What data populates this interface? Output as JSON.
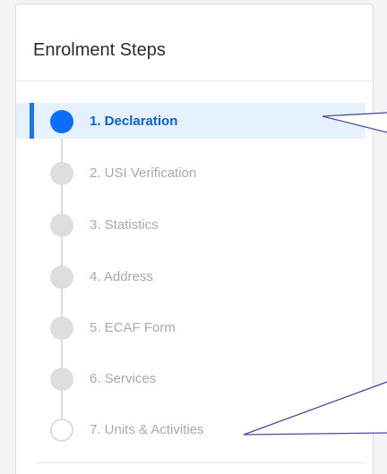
{
  "panel": {
    "title": "Enrolment Steps"
  },
  "steps": [
    {
      "label": "1. Declaration",
      "state": "current"
    },
    {
      "label": "2. USI Verification",
      "state": "pending"
    },
    {
      "label": "3. Statistics",
      "state": "pending"
    },
    {
      "label": "4. Address",
      "state": "pending"
    },
    {
      "label": "5. ECAF Form",
      "state": "pending"
    },
    {
      "label": "6. Services",
      "state": "pending"
    },
    {
      "label": "7. Units & Activities",
      "state": "pending-last"
    }
  ],
  "colors": {
    "accent": "#1a73e8",
    "active_bg": "#e6f1ff",
    "muted_text": "#a7a9ad",
    "callout_line": "#4a4a9c"
  }
}
